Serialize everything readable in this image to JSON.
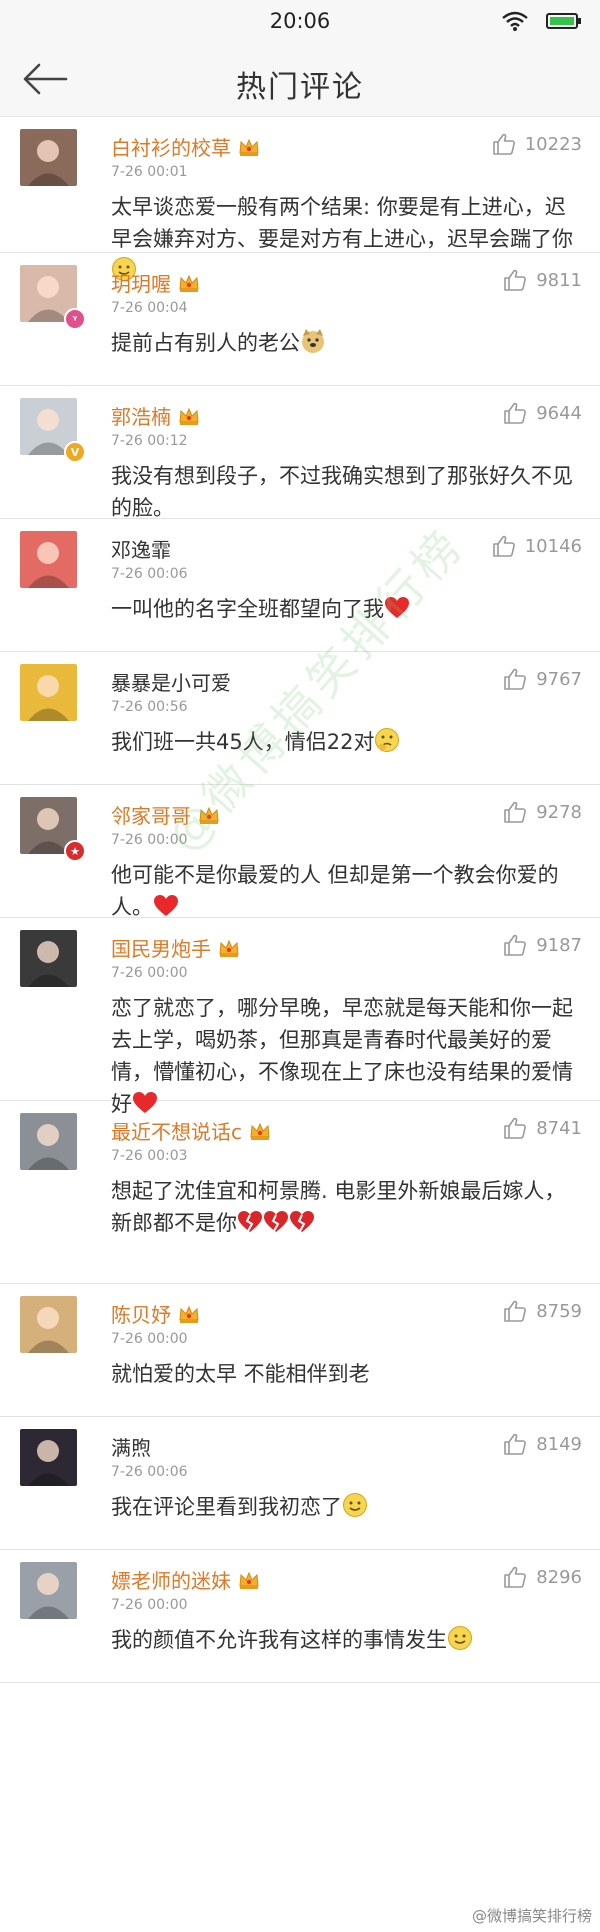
{
  "status": {
    "time": "20:06"
  },
  "header": {
    "title": "热门评论"
  },
  "comments": [
    {
      "name": "白衬衫的校草",
      "vip": true,
      "time": "7-26 00:01",
      "likes": "10223",
      "text": "太早谈恋爱一般有两个结果: 你要是有上进心，迟早会嫌弃对方、要是对方有上进心，迟早会踹了你",
      "emoji": [
        "smile"
      ],
      "avatar": "#8a6a5a",
      "badge": ""
    },
    {
      "name": "玥玥喔",
      "vip": true,
      "time": "7-26 00:04",
      "likes": "9811",
      "text": "提前占有别人的老公",
      "emoji": [
        "doge"
      ],
      "avatar": "#d9b9a9",
      "badge": "pink"
    },
    {
      "name": "郭浩楠",
      "vip": true,
      "time": "7-26 00:12",
      "likes": "9644",
      "text": "我没有想到段子，不过我确实想到了那张好久不见的脸。",
      "emoji": [],
      "avatar": "#c9cfd4",
      "badge": "yellow"
    },
    {
      "name": "邓逸霏",
      "vip": false,
      "time": "7-26 00:06",
      "likes": "10146",
      "text": "一叫他的名字全班都望向了我",
      "emoji": [
        "heart"
      ],
      "avatar": "#e46a64",
      "badge": ""
    },
    {
      "name": "暴暴是小可爱",
      "vip": false,
      "time": "7-26 00:56",
      "likes": "9767",
      "text": "我们班一共45人，情侣22对",
      "emoji": [
        "think"
      ],
      "avatar": "#e8b93a",
      "badge": ""
    },
    {
      "name": "邻家哥哥",
      "vip": true,
      "time": "7-26 00:00",
      "likes": "9278",
      "text": "他可能不是你最爱的人 但却是第一个教会你爱的人。",
      "emoji": [
        "heart"
      ],
      "avatar": "#7e6e68",
      "badge": "red"
    },
    {
      "name": "国民男炮手",
      "vip": true,
      "time": "7-26 00:00",
      "likes": "9187",
      "text": "恋了就恋了，哪分早晚，早恋就是每天能和你一起去上学，喝奶茶，但那真是青春时代最美好的爱情，懵懂初心，不像现在上了床也没有结果的爱情好",
      "emoji": [
        "heart"
      ],
      "avatar": "#3a3a3a",
      "badge": ""
    },
    {
      "name": "最近不想说话c",
      "vip": true,
      "time": "7-26 00:03",
      "likes": "8741",
      "text": "想起了沈佳宜和柯景腾.  电影里外新娘最后嫁人，新郎都不是你",
      "emoji": [
        "broken",
        "broken",
        "broken"
      ],
      "avatar": "#8a9096",
      "badge": ""
    },
    {
      "name": "陈贝妤",
      "vip": true,
      "time": "7-26 00:00",
      "likes": "8759",
      "text": "就怕爱的太早 不能相伴到老",
      "emoji": [],
      "avatar": "#d6b07a",
      "badge": ""
    },
    {
      "name": "满煦",
      "vip": false,
      "time": "7-26 00:06",
      "likes": "8149",
      "text": "我在评论里看到我初恋了",
      "emoji": [
        "smile"
      ],
      "avatar": "#2d2833",
      "badge": ""
    },
    {
      "name": "嫖老师的迷妹",
      "vip": true,
      "time": "7-26 00:00",
      "likes": "8296",
      "text": "我的颜值不允许我有这样的事情发生",
      "emoji": [
        "smile"
      ],
      "avatar": "#9aa0a8",
      "badge": ""
    }
  ],
  "watermark": "@微博搞笑排行榜",
  "corner_mark": "@微博搞笑排行榜",
  "colors": {
    "name_orange": "#e07826",
    "meta_gray": "#999999",
    "divider": "#e3e3e3"
  },
  "icons": {
    "back": "arrow-left-icon",
    "like": "thumbs-up-icon",
    "vip": "crown-vip-icon"
  }
}
